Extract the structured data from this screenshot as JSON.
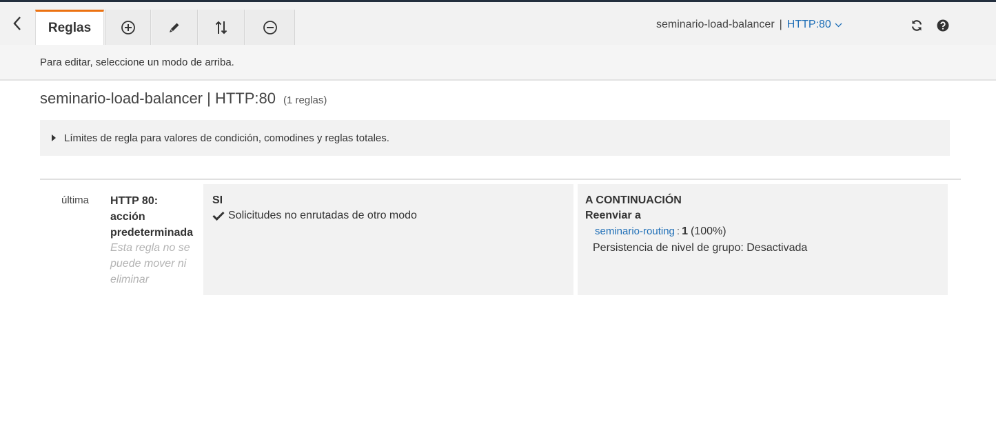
{
  "toolbar": {
    "active_tab": "Reglas",
    "load_balancer": "seminario-load-balancer",
    "separator": "|",
    "listener": "HTTP:80"
  },
  "hint": "Para editar, seleccione un modo de arriba.",
  "page": {
    "title": "seminario-load-balancer | HTTP:80",
    "rule_count": "(1 reglas)"
  },
  "limits_text": "Límites de regla para valores de condición, comodines y reglas totales.",
  "rule": {
    "order": "última",
    "name_lines": [
      "HTTP 80:",
      "acción",
      "predeterminada"
    ],
    "note_lines": [
      "Esta regla no se",
      "puede mover ni",
      "eliminar"
    ],
    "if_header": "SI",
    "condition": "Solicitudes no enrutadas de otro modo",
    "then_header": "A CONTINUACIÓN",
    "action": "Reenviar a",
    "target_group": "seminario-routing",
    "colon": ":",
    "weight": "1",
    "percent": "(100%)",
    "persistence": "Persistencia de nivel de grupo: Desactivada"
  },
  "icons": [
    "chevron-left-icon",
    "plus-circle-icon",
    "pencil-icon",
    "reorder-icon",
    "minus-circle-icon",
    "chevron-down-icon",
    "refresh-icon",
    "help-icon",
    "check-icon",
    "caret-right-icon"
  ],
  "colors": {
    "accent": "#ec7211",
    "link": "#1f6fb7"
  }
}
